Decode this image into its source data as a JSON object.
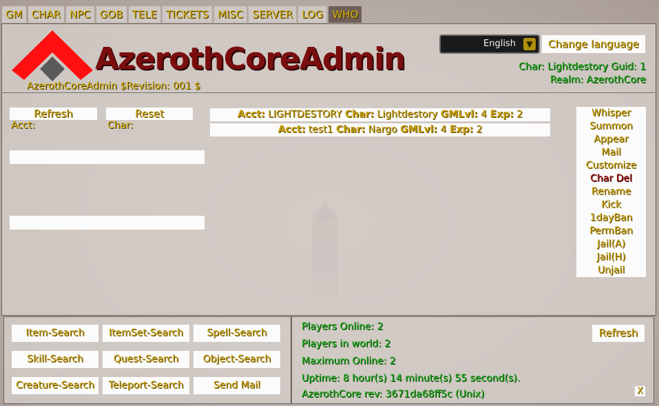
{
  "nav": {
    "tabs": [
      {
        "label": "GM",
        "active": false
      },
      {
        "label": "CHAR",
        "active": false
      },
      {
        "label": "NPC",
        "active": false
      },
      {
        "label": "GOB",
        "active": false
      },
      {
        "label": "TELE",
        "active": false
      },
      {
        "label": "TICKETS",
        "active": false
      },
      {
        "label": "MISC",
        "active": false
      },
      {
        "label": "SERVER",
        "active": false
      },
      {
        "label": "LOG",
        "active": false
      },
      {
        "label": "WHO",
        "active": true
      }
    ]
  },
  "header": {
    "logo_title": "AzerothCoreAdmin",
    "revision": "AzerothCoreAdmin $Revision: 001 $",
    "language_selected": "English",
    "change_language": "Change language",
    "char_line": "Char: Lightdestory Guid: 1",
    "realm_line": "Realm: AzerothCore"
  },
  "search": {
    "refresh": "Refresh",
    "reset": "Reset",
    "acct_label": "Acct:",
    "char_label": "Char:"
  },
  "results": [
    {
      "acct_k": "Acct:",
      "acct": "LIGHTDESTORY",
      "char_k": "Char:",
      "char": "Lightdestory",
      "gm_k": "GMLvl:",
      "gm": "4",
      "exp_k": "Exp:",
      "exp": "2"
    },
    {
      "acct_k": "Acct:",
      "acct": "test1",
      "char_k": "Char:",
      "char": "Nargo",
      "gm_k": "GMLvl:",
      "gm": "4",
      "exp_k": "Exp:",
      "exp": "2"
    }
  ],
  "actions": [
    {
      "label": "Whisper"
    },
    {
      "label": "Summon"
    },
    {
      "label": "Appear"
    },
    {
      "label": "Mail"
    },
    {
      "label": "Customize"
    },
    {
      "label": "Char Del",
      "danger": true
    },
    {
      "label": "Rename"
    },
    {
      "label": "Kick"
    },
    {
      "label": "1dayBan"
    },
    {
      "label": "PermBan"
    },
    {
      "label": "Jail(A)"
    },
    {
      "label": "Jail(H)"
    },
    {
      "label": "Unjail"
    }
  ],
  "search_buttons": [
    "Item-Search",
    "ItemSet-Search",
    "Spell-Search",
    "Skill-Search",
    "Quest-Search",
    "Object-Search",
    "Creature-Search",
    "Teleport-Search",
    "Send Mail"
  ],
  "server_stats": {
    "players_online": "Players Online: 2",
    "players_in_world": "Players in world: 2",
    "maximum_online": "Maximum Online: 2",
    "uptime": "Uptime: 8 hour(s) 14 minute(s) 55 second(s).",
    "rev": "AzerothCore rev: 3671da68ff5c (Unix)",
    "refresh": "Refresh",
    "close": "X"
  },
  "colors": {
    "gold": "#d7b20a",
    "green": "#1fb01b",
    "logo_red": "#7a0e0e",
    "danger": "#9e0b0b"
  }
}
